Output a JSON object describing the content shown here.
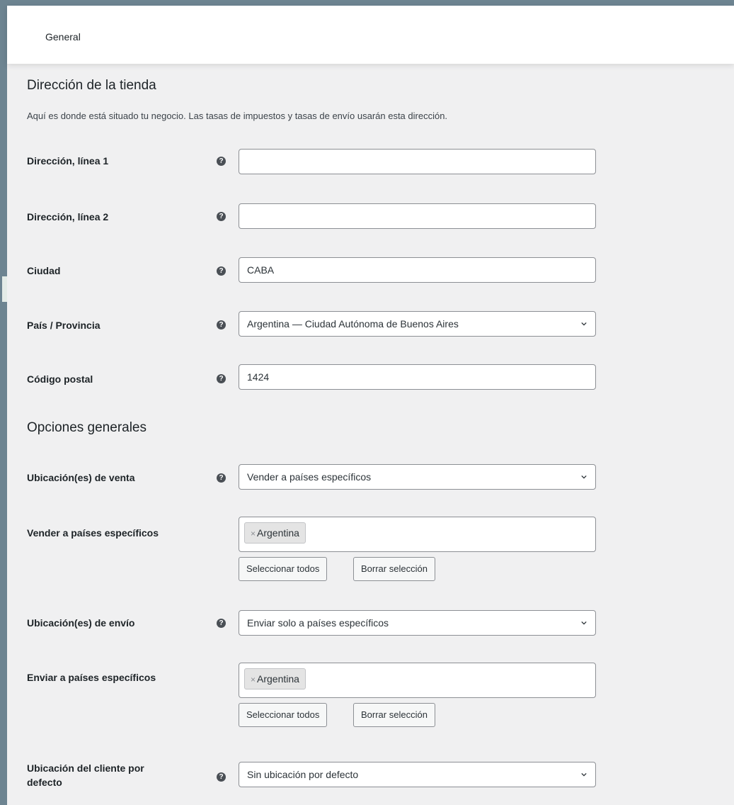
{
  "header": {
    "tab_label": "General"
  },
  "store_address": {
    "title": "Dirección de la tienda",
    "description": "Aquí es donde está situado tu negocio. Las tasas de impuestos y tasas de envío usarán esta dirección.",
    "address1": {
      "label": "Dirección, línea 1",
      "value": ""
    },
    "address2": {
      "label": "Dirección, línea 2",
      "value": ""
    },
    "city": {
      "label": "Ciudad",
      "value": "CABA"
    },
    "country": {
      "label": "País / Provincia",
      "value": "Argentina — Ciudad Autónoma de Buenos Aires"
    },
    "postcode": {
      "label": "Código postal",
      "value": "1424"
    }
  },
  "general_options": {
    "title": "Opciones generales",
    "selling_locations": {
      "label": "Ubicación(es) de venta",
      "value": "Vender a países específicos"
    },
    "specific_selling": {
      "label": "Vender a países específicos",
      "chips": [
        "Argentina"
      ],
      "select_all_label": "Seleccionar todos",
      "clear_label": "Borrar selección"
    },
    "shipping_locations": {
      "label": "Ubicación(es) de envío",
      "value": "Enviar solo a países específicos"
    },
    "specific_shipping": {
      "label": "Enviar a países específicos",
      "chips": [
        "Argentina"
      ],
      "select_all_label": "Seleccionar todos",
      "clear_label": "Borrar selección"
    },
    "default_customer_location": {
      "label_line1": "Ubicación del cliente por",
      "label_line2": "defecto",
      "value": "Sin ubicación por defecto"
    }
  },
  "icons": {
    "help": "question-circle-icon",
    "dropdown": "chevron-down-icon",
    "chip_remove": "x"
  },
  "colors": {
    "frame": "#6d8491",
    "panel_bg": "#f0f0f1",
    "border": "#8c8f94"
  }
}
